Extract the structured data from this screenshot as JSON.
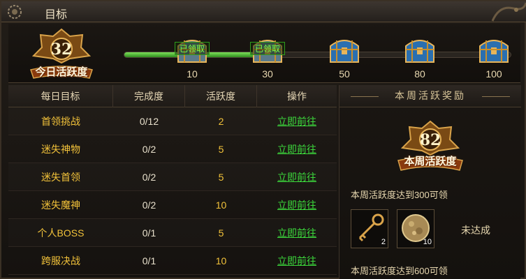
{
  "window": {
    "title": "目标",
    "icon": "gear-icon"
  },
  "activity": {
    "today_points": "32",
    "today_label": "今日活跃度",
    "progress_fraction": 0.4,
    "milestones": [
      {
        "value": "10",
        "claimed_label": "已领取",
        "icon": "treasure-chest-icon"
      },
      {
        "value": "30",
        "claimed_label": "已领取",
        "icon": "treasure-chest-icon"
      },
      {
        "value": "50",
        "claimed_label": "",
        "icon": "treasure-chest-icon"
      },
      {
        "value": "80",
        "claimed_label": "",
        "icon": "treasure-chest-icon"
      },
      {
        "value": "100",
        "claimed_label": "",
        "icon": "treasure-chest-icon"
      }
    ]
  },
  "table": {
    "headers": [
      "每日目标",
      "完成度",
      "活跃度",
      "操作"
    ],
    "rows": [
      {
        "name": "首领挑战",
        "progress": "0/12",
        "points": "2",
        "action": "立即前往"
      },
      {
        "name": "迷失神物",
        "progress": "0/2",
        "points": "5",
        "action": "立即前往"
      },
      {
        "name": "迷失首领",
        "progress": "0/2",
        "points": "5",
        "action": "立即前往"
      },
      {
        "name": "迷失魔神",
        "progress": "0/2",
        "points": "10",
        "action": "立即前往"
      },
      {
        "name": "个人BOSS",
        "progress": "0/1",
        "points": "5",
        "action": "立即前往"
      },
      {
        "name": "跨服决战",
        "progress": "0/1",
        "points": "10",
        "action": "立即前往"
      }
    ]
  },
  "weekly": {
    "title": "本周活跃奖励",
    "week_points": "82",
    "week_label": "本周活跃度",
    "reward1_text": "本周活跃度达到300可领",
    "items": [
      {
        "icon": "golden-key-icon",
        "count": "2"
      },
      {
        "icon": "gold-ore-icon",
        "count": "10"
      }
    ],
    "status": "未达成",
    "reward2_text": "本周活跃度达到600可领"
  },
  "colors": {
    "accent_gold": "#f2c23a",
    "link_green": "#3cd93c",
    "claimed_green": "#7dff4a"
  }
}
